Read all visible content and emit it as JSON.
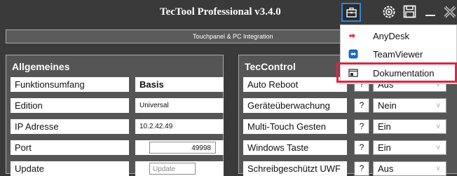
{
  "window": {
    "title": "TecTool Professional v3.4.0",
    "subtitle": "Touchpanel & PC Integration"
  },
  "tools_menu": {
    "items": [
      {
        "label": "AnyDesk",
        "icon": "anydesk-icon"
      },
      {
        "label": "TeamViewer",
        "icon": "teamviewer-icon"
      },
      {
        "label": "Dokumentation",
        "icon": "documentation-icon"
      }
    ]
  },
  "general": {
    "heading": "Allgemeines",
    "rows": [
      {
        "label": "Funktionsumfang",
        "value": "Basis"
      },
      {
        "label": "Edition",
        "value": "Universal"
      },
      {
        "label": "IP Adresse",
        "value": "10.2.42.49"
      },
      {
        "label": "Port",
        "value": "49998"
      },
      {
        "label": "Update",
        "value": "Update"
      }
    ]
  },
  "teccontrol": {
    "heading": "TecControl",
    "help_label": "?",
    "rows": [
      {
        "label": "Auto Reboot",
        "value": "Aus"
      },
      {
        "label": "Geräteüberwachung",
        "value": "Nein"
      },
      {
        "label": "Multi-Touch Gesten",
        "value": "Ein"
      },
      {
        "label": "Windows Taste",
        "value": "Ein"
      },
      {
        "label": "Schreibgeschützt UWF",
        "value": "Aus"
      }
    ]
  },
  "colors": {
    "highlight": "#e0243d",
    "accent_border": "#2f88d6",
    "anydesk": "#e8333a",
    "teamviewer": "#1a68c3"
  }
}
